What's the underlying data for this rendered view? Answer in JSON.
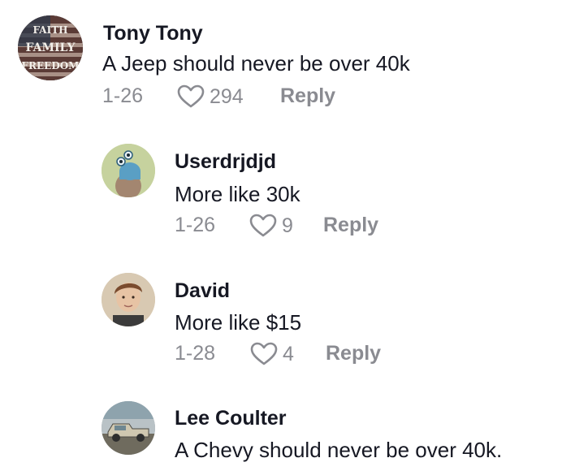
{
  "comments": [
    {
      "username": "Tony Tony",
      "text": "A Jeep should never be over 40k",
      "date": "1-26",
      "likes": "294",
      "reply_label": "Reply",
      "avatar_text": [
        "FAITH",
        "FAMILY",
        "FREEDOM"
      ]
    },
    {
      "username": "Userdrjdjd",
      "text": "More like 30k",
      "date": "1-26",
      "likes": "9",
      "reply_label": "Reply"
    },
    {
      "username": "David",
      "text": "More like $15",
      "date": "1-28",
      "likes": "4",
      "reply_label": "Reply"
    },
    {
      "username": "Lee Coulter",
      "text": "A Chevy should never be over 40k."
    }
  ],
  "colors": {
    "text_primary": "#161823",
    "text_secondary": "#8a8b91",
    "background": "#ffffff"
  }
}
